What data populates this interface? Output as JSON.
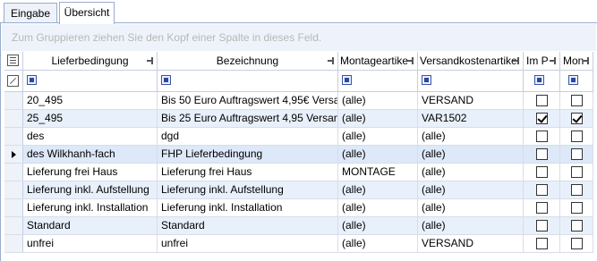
{
  "tabs": [
    {
      "label": "Eingabe"
    },
    {
      "label": "Übersicht"
    }
  ],
  "group_hint": "Zum Gruppieren ziehen Sie den Kopf einer Spalte in dieses Feld.",
  "columns": [
    {
      "label": "Lieferbedingung"
    },
    {
      "label": "Bezeichnung"
    },
    {
      "label": "Montageartike"
    },
    {
      "label": "Versandkostenartike"
    },
    {
      "label": "Im P"
    },
    {
      "label": "Mon"
    }
  ],
  "rows": [
    {
      "lieferbedingung": "20_495",
      "bezeichnung": "Bis 50 Euro Auftragswert 4,95€ Versa",
      "montage": "(alle)",
      "versand": "VERSAND",
      "im_p": false,
      "mon": false
    },
    {
      "lieferbedingung": "25_495",
      "bezeichnung": "Bis 25 Euro Auftragswert 4,95 Versan",
      "montage": "(alle)",
      "versand": "VAR1502",
      "im_p": true,
      "mon": true
    },
    {
      "lieferbedingung": "des",
      "bezeichnung": "dgd",
      "montage": "(alle)",
      "versand": "(alle)",
      "im_p": false,
      "mon": false
    },
    {
      "lieferbedingung": "des Wilkhanh-fach",
      "bezeichnung": "FHP Lieferbedingung",
      "montage": "(alle)",
      "versand": "(alle)",
      "im_p": false,
      "mon": false,
      "current": true
    },
    {
      "lieferbedingung": "Lieferung frei Haus",
      "bezeichnung": "Lieferung frei Haus",
      "montage": "MONTAGE",
      "versand": "(alle)",
      "im_p": false,
      "mon": false
    },
    {
      "lieferbedingung": "Lieferung inkl. Aufstellung",
      "bezeichnung": "Lieferung inkl. Aufstellung",
      "montage": "(alle)",
      "versand": "(alle)",
      "im_p": false,
      "mon": false
    },
    {
      "lieferbedingung": "Lieferung inkl. Installation",
      "bezeichnung": "Lieferung inkl. Installation",
      "montage": "(alle)",
      "versand": "(alle)",
      "im_p": false,
      "mon": false
    },
    {
      "lieferbedingung": "Standard",
      "bezeichnung": "Standard",
      "montage": "(alle)",
      "versand": "(alle)",
      "im_p": false,
      "mon": false
    },
    {
      "lieferbedingung": "unfrei",
      "bezeichnung": "unfrei",
      "montage": "(alle)",
      "versand": "VERSAND",
      "im_p": false,
      "mon": false
    }
  ],
  "icons": {
    "column_chooser": "column-chooser-icon",
    "filter_clear": "filter-clear-icon",
    "pin": "pin-icon",
    "filter": "filter-button-icon",
    "row_indicator": "current-row-arrow-icon"
  },
  "colors": {
    "border": "#9aaccc",
    "row_alt": "#e8f0fb",
    "hint_text": "#b7b7b7"
  }
}
